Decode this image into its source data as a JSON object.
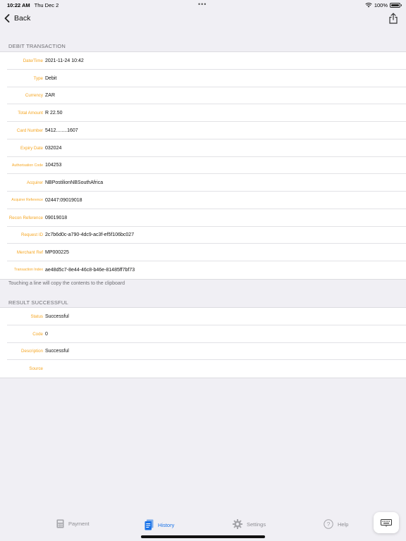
{
  "status_bar": {
    "time": "10:22 AM",
    "date": "Thu Dec 2",
    "battery": "100%",
    "dots": "•••"
  },
  "nav": {
    "back_label": "Back",
    "back_icon": "chevron-left-icon",
    "share_icon": "share-icon"
  },
  "debit_section": {
    "header": "DEBIT TRANSACTION",
    "rows": [
      {
        "key": "Date/Time",
        "value": "2021-11-24 10:42"
      },
      {
        "key": "Type",
        "value": "Debit"
      },
      {
        "key": "Currency",
        "value": "ZAR"
      },
      {
        "key": "Total Amount",
        "value": "R 22.50"
      },
      {
        "key": "Card Number",
        "value": "5412........1607"
      },
      {
        "key": "Expiry Date",
        "value": "032024"
      },
      {
        "key": "Authorisation Code",
        "value": "104253"
      },
      {
        "key": "Acquirer",
        "value": "NBPostilionNBSouthAfrica"
      },
      {
        "key": "Acquirer Reference",
        "value": "02447:09019018"
      },
      {
        "key": "Recon Reference",
        "value": "09019018"
      },
      {
        "key": "Request ID",
        "value": "2c7b6d0c-a790-4dc9-ac3f-ef5f106bc027"
      },
      {
        "key": "Merchant Ref",
        "value": "MP000225"
      },
      {
        "key": "Transaction Index",
        "value": "ae48d5c7-8e44-46c8-b46e-81485ff7bf73"
      }
    ],
    "footer": "Touching a line will copy the contents to the clipboard"
  },
  "result_section": {
    "header": "RESULT SUCCESSFUL",
    "rows": [
      {
        "key": "Status",
        "value": "Successful"
      },
      {
        "key": "Code",
        "value": "0"
      },
      {
        "key": "Description",
        "value": "Successful"
      },
      {
        "key": "Source",
        "value": ""
      }
    ]
  },
  "tabs": [
    {
      "label": "Payment",
      "icon": "payment-icon",
      "active": false
    },
    {
      "label": "History",
      "icon": "history-icon",
      "active": true
    },
    {
      "label": "Settings",
      "icon": "gear-icon",
      "active": false
    },
    {
      "label": "Help",
      "icon": "help-icon",
      "active": false
    }
  ],
  "colors": {
    "key_orange": "#f5a623",
    "accent_blue": "#1a73e8",
    "inactive_gray": "#8e8e93",
    "background": "#f0eff4"
  }
}
